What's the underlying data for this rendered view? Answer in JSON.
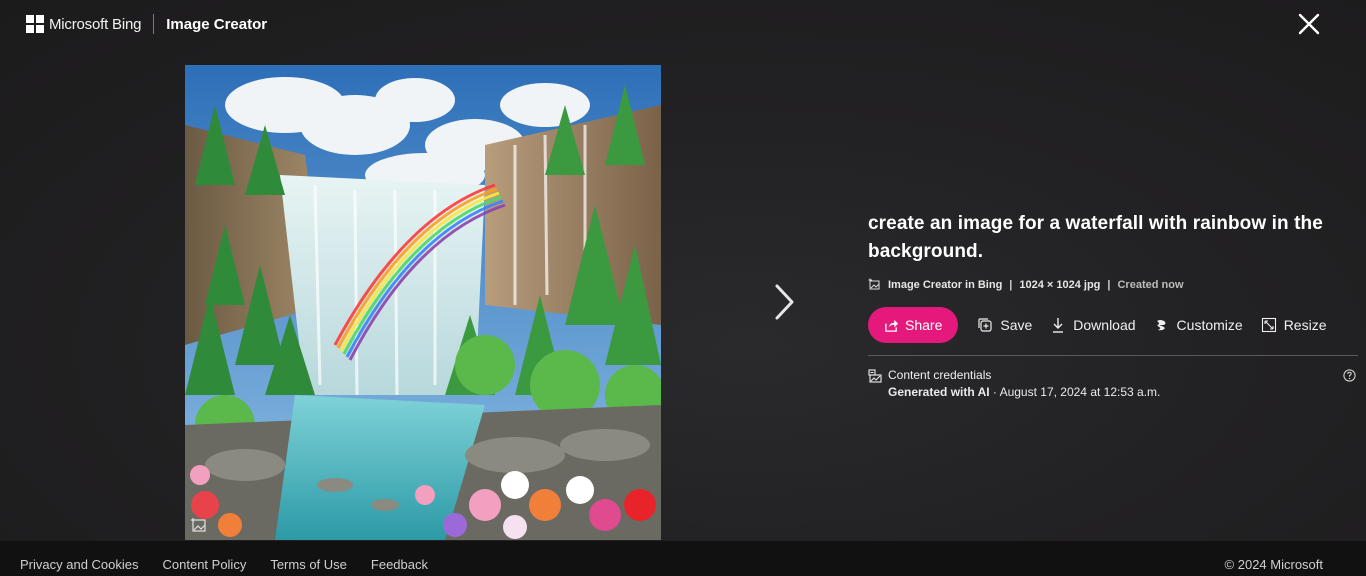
{
  "header": {
    "brand_name": "Microsoft Bing",
    "product_name": "Image Creator",
    "close_label": "Close"
  },
  "image": {
    "alt": "A waterfall with a rainbow in the background, surrounded by pine trees and colorful flowers",
    "badge_icon": "ai-generated-image-icon"
  },
  "navigation": {
    "next_icon": "chevron-right-icon"
  },
  "details": {
    "prompt": "create an image for a waterfall with rainbow in the background.",
    "meta": {
      "source": "Image Creator in Bing",
      "dimensions": "1024 × 1024 jpg",
      "created": "Created now",
      "separator": "|"
    },
    "actions": {
      "share": "Share",
      "save": "Save",
      "download": "Download",
      "customize": "Customize",
      "resize": "Resize"
    },
    "credentials": {
      "title": "Content credentials",
      "generated_label": "Generated with AI",
      "generated_date": " · August 17, 2024 at 12:53 a.m."
    }
  },
  "footer": {
    "links": [
      "Privacy and Cookies",
      "Content Policy",
      "Terms of Use",
      "Feedback"
    ],
    "copyright": "© 2024 Microsoft"
  },
  "colors": {
    "accent": "#e5197b",
    "background": "#1f1e1f",
    "footer": "#111111"
  }
}
